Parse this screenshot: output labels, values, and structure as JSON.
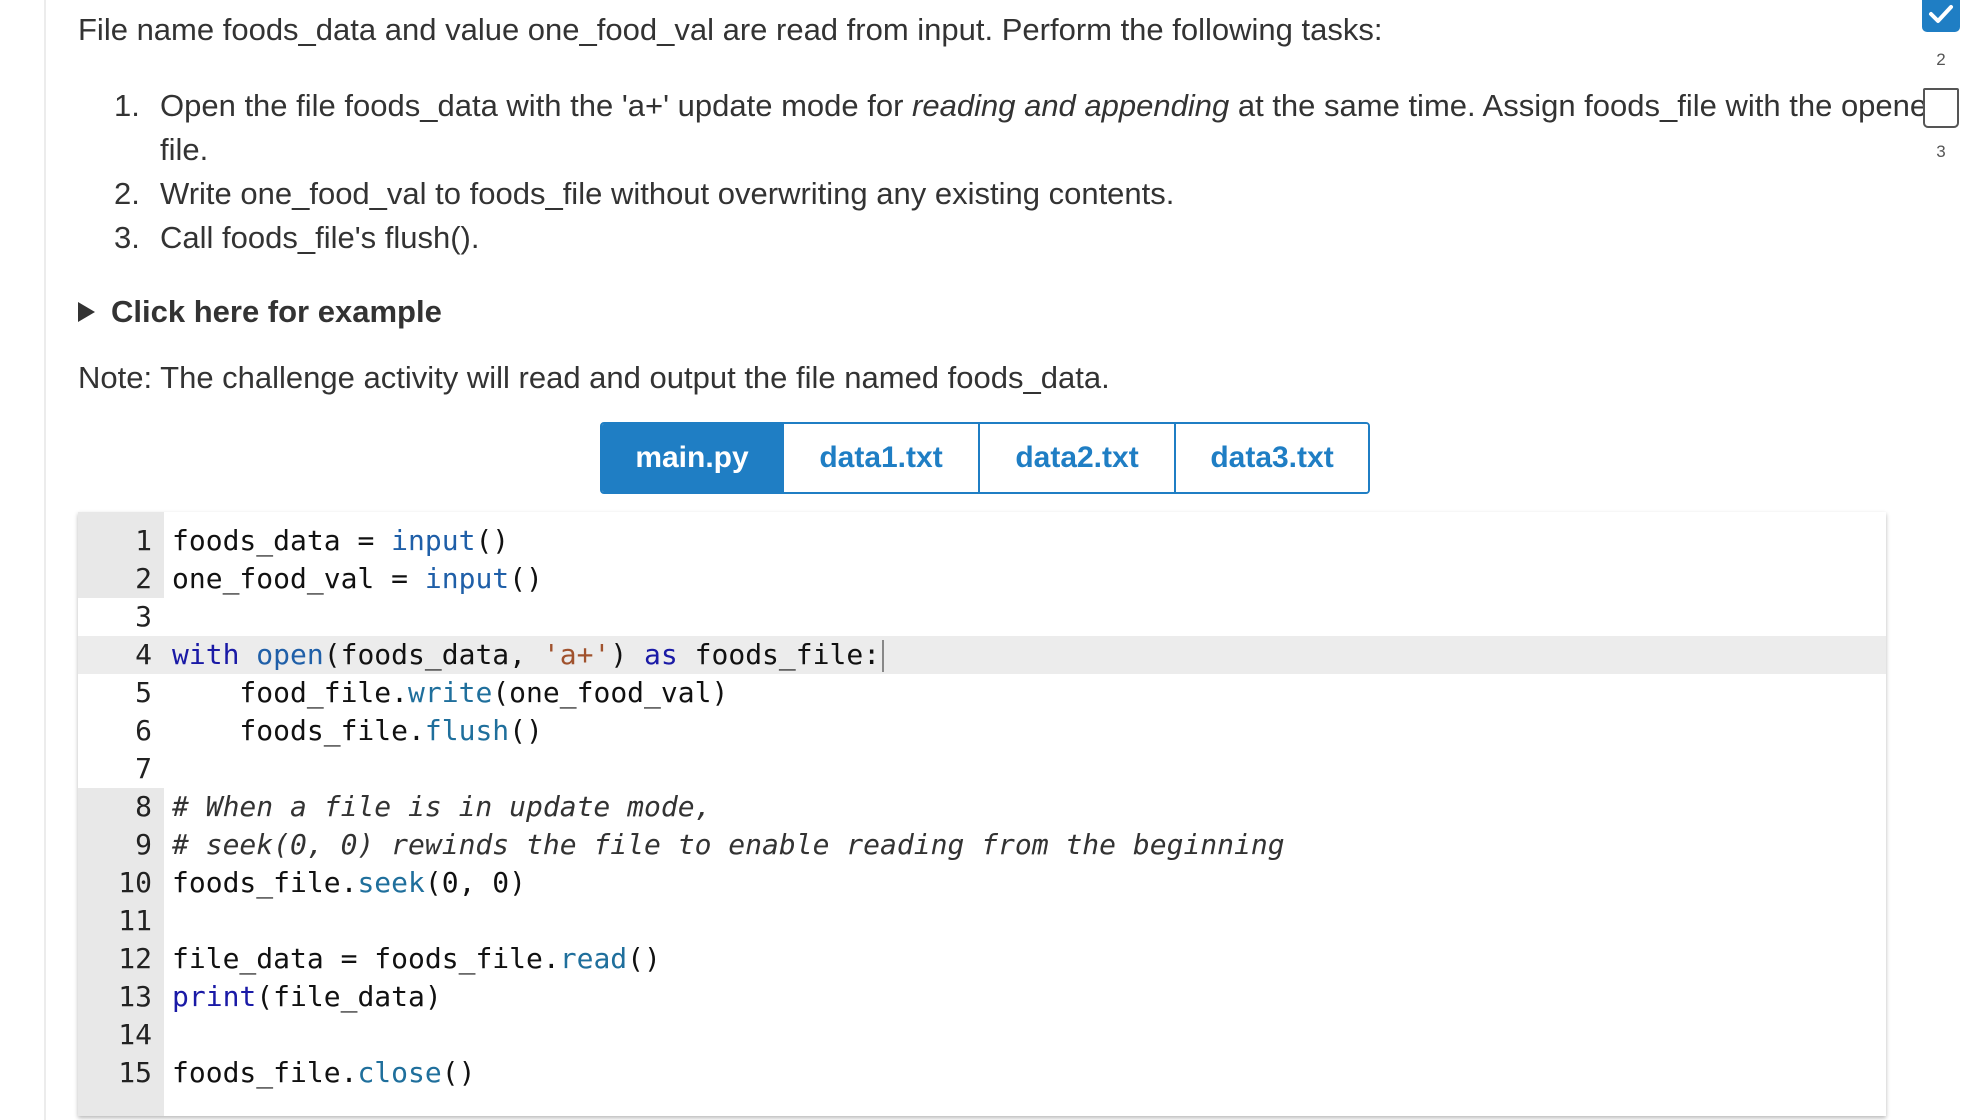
{
  "prompt": {
    "intro": "File name foods_data and value one_food_val are read from input. Perform the following tasks:",
    "tasks": [
      {
        "num": "1.",
        "pre": "Open the file foods_data with the 'a+' update mode for ",
        "em": "reading and appending",
        "post": " at the same time. Assign foods_file with the opened file."
      },
      {
        "num": "2.",
        "text": "Write one_food_val to foods_file without overwriting any existing contents."
      },
      {
        "num": "3.",
        "text": "Call foods_file's flush()."
      }
    ],
    "example_toggle": "Click here for example",
    "note": "Note: The challenge activity will read and output the file named foods_data."
  },
  "tabs": [
    {
      "label": "main.py",
      "active": true
    },
    {
      "label": "data1.txt",
      "active": false
    },
    {
      "label": "data2.txt",
      "active": false
    },
    {
      "label": "data3.txt",
      "active": false
    }
  ],
  "editor": {
    "active_line": 4,
    "lines": [
      {
        "n": "1",
        "tokens": [
          [
            "",
            "foods_data "
          ],
          [
            "",
            "= "
          ],
          [
            "bi",
            "input"
          ],
          [
            "",
            "()"
          ]
        ]
      },
      {
        "n": "2",
        "tokens": [
          [
            "",
            "one_food_val "
          ],
          [
            "",
            "= "
          ],
          [
            "bi",
            "input"
          ],
          [
            "",
            "()"
          ]
        ]
      },
      {
        "n": "3",
        "tokens": []
      },
      {
        "n": "4",
        "tokens": [
          [
            "kw",
            "with "
          ],
          [
            "bi",
            "open"
          ],
          [
            "",
            "(foods_data, "
          ],
          [
            "str",
            "'a+'"
          ],
          [
            "",
            ") "
          ],
          [
            "kw",
            "as"
          ],
          [
            "",
            " foods_file:"
          ]
        ]
      },
      {
        "n": "5",
        "tokens": [
          [
            "",
            "    food_file."
          ],
          [
            "fn",
            "write"
          ],
          [
            "",
            "(one_food_val)"
          ]
        ]
      },
      {
        "n": "6",
        "tokens": [
          [
            "",
            "    foods_file."
          ],
          [
            "fn",
            "flush"
          ],
          [
            "",
            "()"
          ]
        ]
      },
      {
        "n": "7",
        "tokens": []
      },
      {
        "n": "8",
        "tokens": [
          [
            "cm",
            "# When a file is in update mode,"
          ]
        ]
      },
      {
        "n": "9",
        "tokens": [
          [
            "cm",
            "# seek(0, 0) rewinds the file to enable reading from the beginning"
          ]
        ]
      },
      {
        "n": "10",
        "tokens": [
          [
            "",
            "foods_file."
          ],
          [
            "fn",
            "seek"
          ],
          [
            "",
            "(0, 0)"
          ]
        ]
      },
      {
        "n": "11",
        "tokens": []
      },
      {
        "n": "12",
        "tokens": [
          [
            "",
            "file_data "
          ],
          [
            "",
            "= "
          ],
          [
            "",
            "foods_file."
          ],
          [
            "fn",
            "read"
          ],
          [
            "",
            "()"
          ]
        ]
      },
      {
        "n": "13",
        "tokens": [
          [
            "kw",
            "print"
          ],
          [
            "",
            "(file_data)"
          ]
        ]
      },
      {
        "n": "14",
        "tokens": []
      },
      {
        "n": "15",
        "tokens": [
          [
            "",
            "foods_file."
          ],
          [
            "fn",
            "close"
          ],
          [
            "",
            "()"
          ]
        ]
      }
    ]
  },
  "progress": {
    "levels": [
      {
        "label": "2",
        "done": true
      },
      {
        "label": "3",
        "done": false
      }
    ]
  },
  "colors": {
    "accent": "#1f7ec4"
  }
}
